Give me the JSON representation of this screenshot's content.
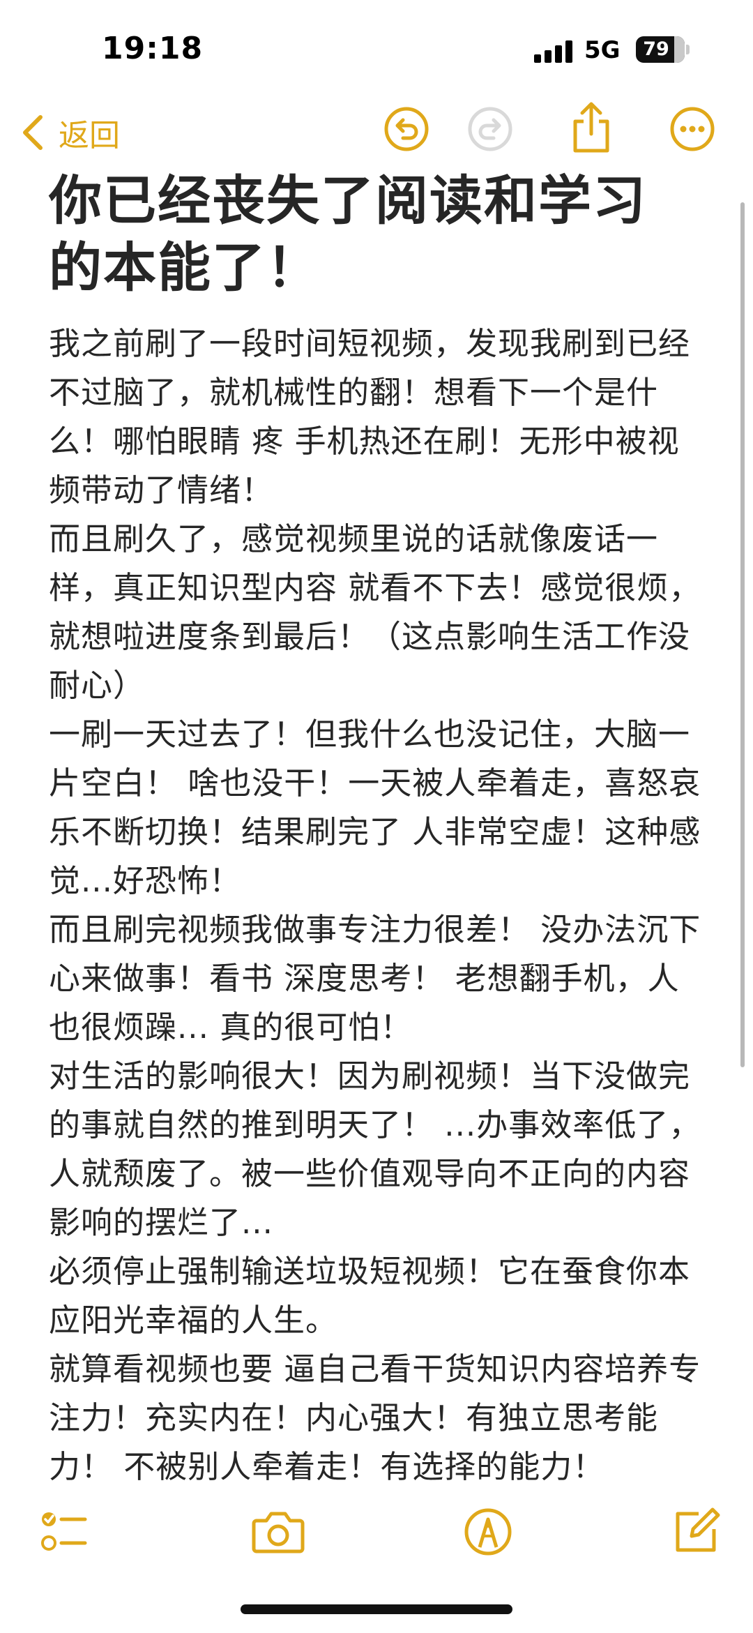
{
  "status_bar": {
    "time": "19:18",
    "network": "5G",
    "battery_percent": "79",
    "battery_level": 0.79
  },
  "nav": {
    "back_label": "返回",
    "icons": [
      "undo-icon",
      "redo-icon",
      "share-icon",
      "more-icon"
    ]
  },
  "note": {
    "title": "你已经丧失了阅读和学习的本能了！",
    "paragraphs": [
      "我之前刷了一段时间短视频，发现我刷到已经不过脑了，就机械性的翻！想看下一个是什么！哪怕眼睛 疼 手机热还在刷！无形中被视频带动了情绪！",
      "而且刷久了，感觉视频里说的话就像废话一样，真正知识型内容 就看不下去！感觉很烦，就想啦进度条到最后！（这点影响生活工作没耐心）",
      "一刷一天过去了！但我什么也没记住，大脑一片空白！ 啥也没干！一天被人牵着走，喜怒哀乐不断切换！结果刷完了 人非常空虚！这种感觉...好恐怖！",
      "而且刷完视频我做事专注力很差！ 没办法沉下心来做事！看书 深度思考！ 老想翻手机，人也很烦躁... 真的很可怕！",
      "对生活的影响很大！因为刷视频！当下没做完的事就自然的推到明天了！ ...办事效率低了，人就颓废了。被一些价值观导向不正向的内容影响的摆烂了...",
      "必须停止强制输送垃圾短视频！它在蚕食你本应阳光幸福的人生。",
      "就算看视频也要 逼自己看干货知识内容培养专注力！充实内在！内心强大！有独立思考能力！ 不被别人牵着走！有选择的能力！"
    ]
  },
  "toolbar": {
    "icons": [
      "checklist-icon",
      "camera-icon",
      "markup-icon",
      "compose-icon"
    ]
  },
  "colors": {
    "accent": "#e0a81a",
    "text": "#262626",
    "disabled": "#d9d9d9"
  }
}
